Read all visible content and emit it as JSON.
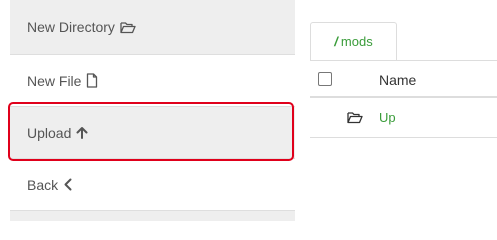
{
  "sidebar": {
    "items": [
      {
        "label": "New Directory",
        "icon": "folder-open-icon"
      },
      {
        "label": "New File",
        "icon": "file-icon"
      },
      {
        "label": "Upload",
        "icon": "arrow-up-icon"
      },
      {
        "label": "Back",
        "icon": "chevron-left-icon"
      }
    ],
    "highlighted_item": "Upload"
  },
  "path_tab": {
    "slash": "/",
    "label": "mods"
  },
  "table": {
    "headers": {
      "name": "Name"
    },
    "rows": [
      {
        "name": "Up",
        "icon": "folder-open-icon"
      }
    ]
  },
  "colors": {
    "highlight": "#e0001b",
    "link": "#3a9c3a",
    "menu_bg": "#eeeeee"
  }
}
